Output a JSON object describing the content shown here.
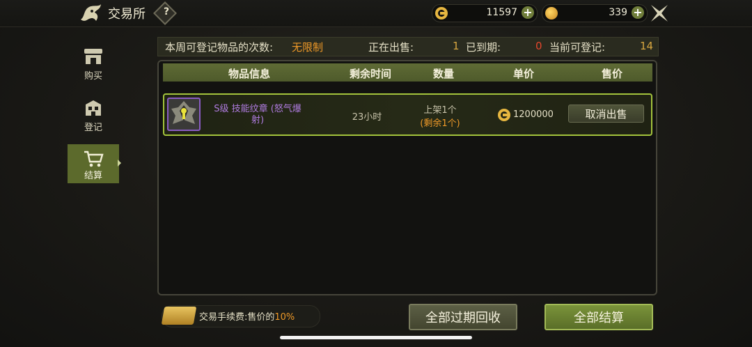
{
  "header": {
    "title": "交易所",
    "help_label": "?",
    "currency1": {
      "icon": "coin-c-icon",
      "value": "11597"
    },
    "currency2": {
      "icon": "gold-coin-icon",
      "value": "339"
    },
    "plus_label": "+"
  },
  "stats": {
    "weekly_label": "本周可登记物品的次数:",
    "weekly_value": "无限制",
    "selling_label": "正在出售:",
    "selling_value": "1",
    "expired_label": "已到期:",
    "expired_value": "0",
    "available_label": "当前可登记:",
    "available_value": "14"
  },
  "sidebar": {
    "items": [
      {
        "label": "购买",
        "icon": "shop-icon"
      },
      {
        "label": "登记",
        "icon": "register-icon"
      },
      {
        "label": "结算",
        "icon": "cart-icon"
      }
    ]
  },
  "table": {
    "headers": [
      "物品信息",
      "剩余时间",
      "数量",
      "单价",
      "售价"
    ],
    "rows": [
      {
        "name": "S级 技能纹章 (怒气爆射)",
        "time": "23小时",
        "qty_listed": "上架1个",
        "qty_remaining": "(剩余1个)",
        "price": "1200000",
        "action": "取消出售"
      }
    ]
  },
  "footer": {
    "fee_label": "交易手续费:售价的",
    "fee_value": "10%",
    "reclaim_button": "全部过期回收",
    "settle_button": "全部结算"
  },
  "colors": {
    "accent": "#a4c43c",
    "orange": "#f09a28",
    "gold": "#e6b640",
    "purple": "#b07ce0"
  }
}
